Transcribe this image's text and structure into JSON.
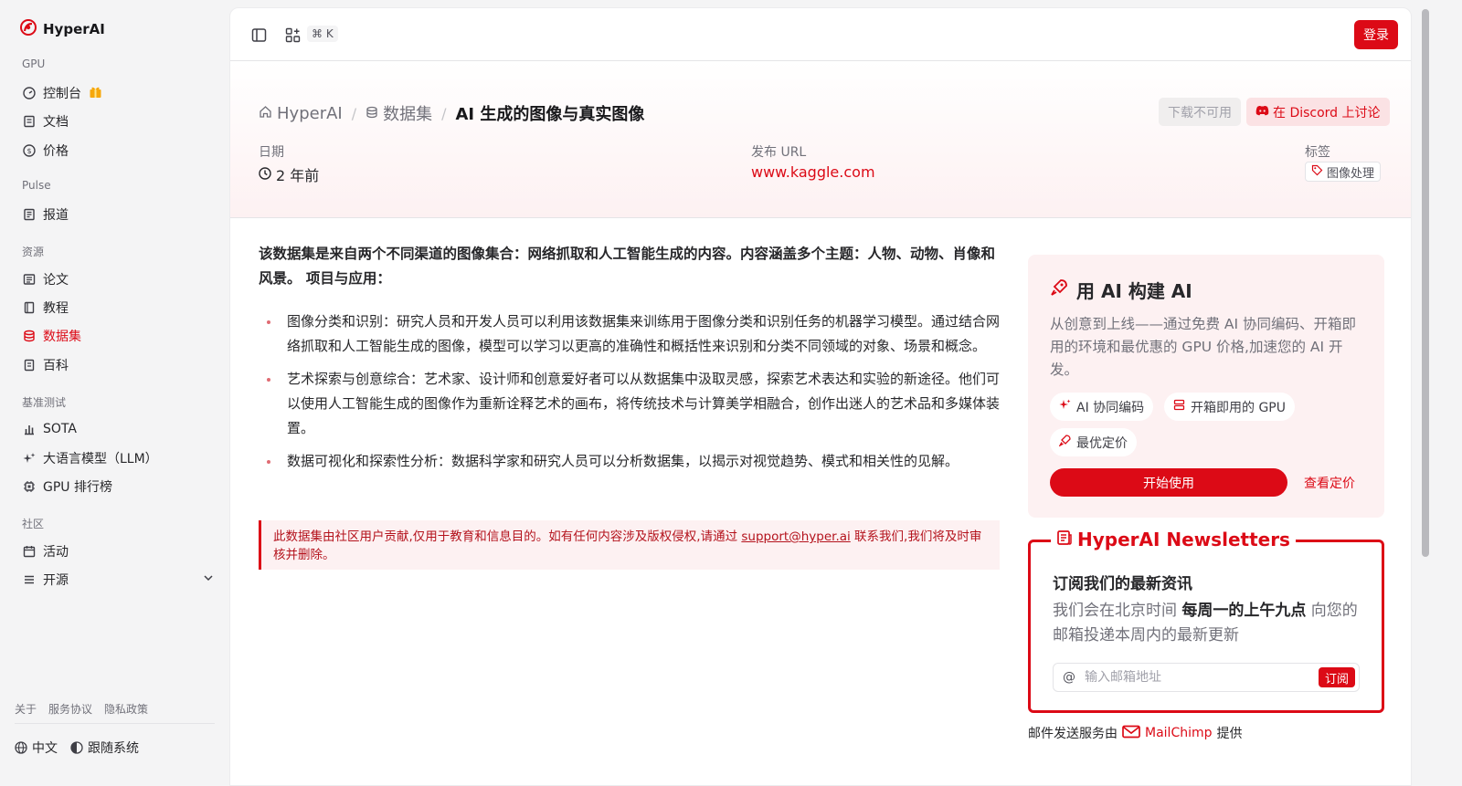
{
  "brand": {
    "name": "HyperAI"
  },
  "sidebar": {
    "sections": [
      {
        "label": "GPU",
        "items": [
          {
            "label": "控制台",
            "icon": "dashboard-icon",
            "badge_icon": "gift-icon"
          },
          {
            "label": "文档",
            "icon": "doc-icon"
          },
          {
            "label": "价格",
            "icon": "dollar-icon"
          }
        ]
      },
      {
        "label": "Pulse",
        "items": [
          {
            "label": "报道",
            "icon": "news-icon"
          }
        ]
      },
      {
        "label": "资源",
        "items": [
          {
            "label": "论文",
            "icon": "paper-icon"
          },
          {
            "label": "教程",
            "icon": "book-icon"
          },
          {
            "label": "数据集",
            "icon": "database-icon",
            "active": true
          },
          {
            "label": "百科",
            "icon": "wiki-icon"
          }
        ]
      },
      {
        "label": "基准测试",
        "items": [
          {
            "label": "SOTA",
            "icon": "bar-chart-icon"
          },
          {
            "label": "大语言模型（LLM）",
            "icon": "sparkle-icon"
          },
          {
            "label": "GPU 排行榜",
            "icon": "chip-icon"
          }
        ]
      },
      {
        "label": "社区",
        "items": [
          {
            "label": "活动",
            "icon": "calendar-icon"
          },
          {
            "label": "开源",
            "icon": "list-icon"
          }
        ]
      }
    ],
    "footer_links": [
      "关于",
      "服务协议",
      "隐私政策"
    ],
    "language": "中文",
    "theme": "跟随系统"
  },
  "topbar": {
    "shortcut": "⌘ K",
    "login": "登录"
  },
  "page": {
    "breadcrumb": {
      "home": "HyperAI",
      "section": "数据集",
      "current": "AI 生成的图像与真实图像"
    },
    "download_disabled": "下载不可用",
    "discord_button": "在 Discord 上讨论",
    "meta": {
      "date_label": "日期",
      "date_value": "2 年前",
      "url_label": "发布 URL",
      "url_value": "www.kaggle.com",
      "tags_label": "标签",
      "tag": "图像处理"
    },
    "intro": "该数据集是来自两个不同渠道的图像集合：网络抓取和人工智能生成的内容。内容涵盖多个主题：人物、动物、肖像和风景。 项目与应用：",
    "bullets": [
      "图像分类和识别：研究人员和开发人员可以利用该数据集来训练用于图像分类和识别任务的机器学习模型。通过结合网络抓取和人工智能生成的图像，模型可以学习以更高的准确性和概括性来识别和分类不同领域的对象、场景和概念。",
      "艺术探索与创意综合：艺术家、设计师和创意爱好者可以从数据集中汲取灵感，探索艺术表达和实验的新途径。他们可以使用人工智能生成的图像作为重新诠释艺术的画布，将传统技术与计算美学相融合，创作出迷人的艺术品和多媒体装置。",
      "数据可视化和探索性分析：数据科学家和研究人员可以分析数据集，以揭示对视觉趋势、模式和相关性的见解。"
    ],
    "notice": {
      "before": "此数据集由社区用户贡献,仅用于教育和信息目的。如有任何内容涉及版权侵权,请通过 ",
      "email": "support@hyper.ai",
      "after": " 联系我们,我们将及时审核并删除。"
    }
  },
  "promo": {
    "title": "用 AI 构建 AI",
    "desc": "从创意到上线——通过免费 AI 协同编码、开箱即用的环境和最优惠的 GPU 价格,加速您的 AI 开发。",
    "chips": [
      "AI 协同编码",
      "开箱即用的 GPU",
      "最优定价"
    ],
    "start": "开始使用",
    "pricing": "查看定价"
  },
  "newsletter": {
    "title": "HyperAI Newsletters",
    "subtitle": "订阅我们的最新资讯",
    "desc_before": "我们会在北京时间 ",
    "desc_bold": "每周一的上午九点",
    "desc_after": " 向您的邮箱投递本周内的最新更新",
    "placeholder": "输入邮箱地址",
    "subscribe": "订阅",
    "credit_before": "邮件发送服务由",
    "credit_brand": "MailChimp",
    "credit_after": "提供"
  },
  "colors": {
    "accent": "#dc0a16",
    "accent_bg": "#fdf1f2"
  }
}
